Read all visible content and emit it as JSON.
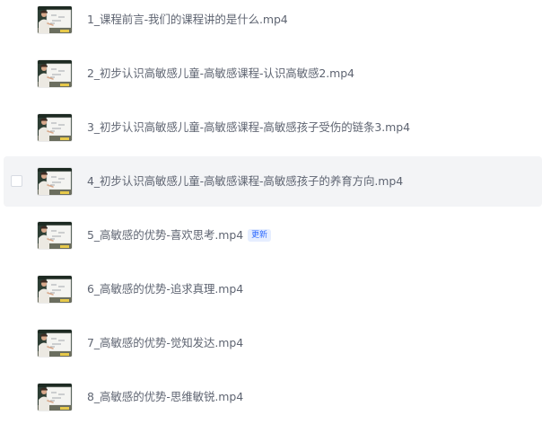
{
  "files": [
    {
      "name": "1_课程前言-我们的课程讲的是什么.mp4",
      "badge": null,
      "hovered": false
    },
    {
      "name": "2_初步认识高敏感儿童-高敏感课程-认识高敏感2.mp4",
      "badge": null,
      "hovered": false
    },
    {
      "name": "3_初步认识高敏感儿童-高敏感课程-高敏感孩子受伤的链条3.mp4",
      "badge": null,
      "hovered": false
    },
    {
      "name": "4_初步认识高敏感儿童-高敏感课程-高敏感孩子的养育方向.mp4",
      "badge": null,
      "hovered": true
    },
    {
      "name": "5_高敏感的优势-喜欢思考.mp4",
      "badge": "更新",
      "hovered": false
    },
    {
      "name": "6_高敏感的优势-追求真理.mp4",
      "badge": null,
      "hovered": false
    },
    {
      "name": "7_高敏感的优势-觉知发达.mp4",
      "badge": null,
      "hovered": false
    },
    {
      "name": "8_高敏感的优势-思维敏锐.mp4",
      "badge": null,
      "hovered": false
    }
  ],
  "thumbnail": {
    "icon": "video-thumbnail-icon"
  },
  "colors": {
    "text": "#5f6572",
    "hover_bg": "#f3f4f6",
    "badge_text": "#2f6bff",
    "badge_bg": "#e6eeff"
  }
}
